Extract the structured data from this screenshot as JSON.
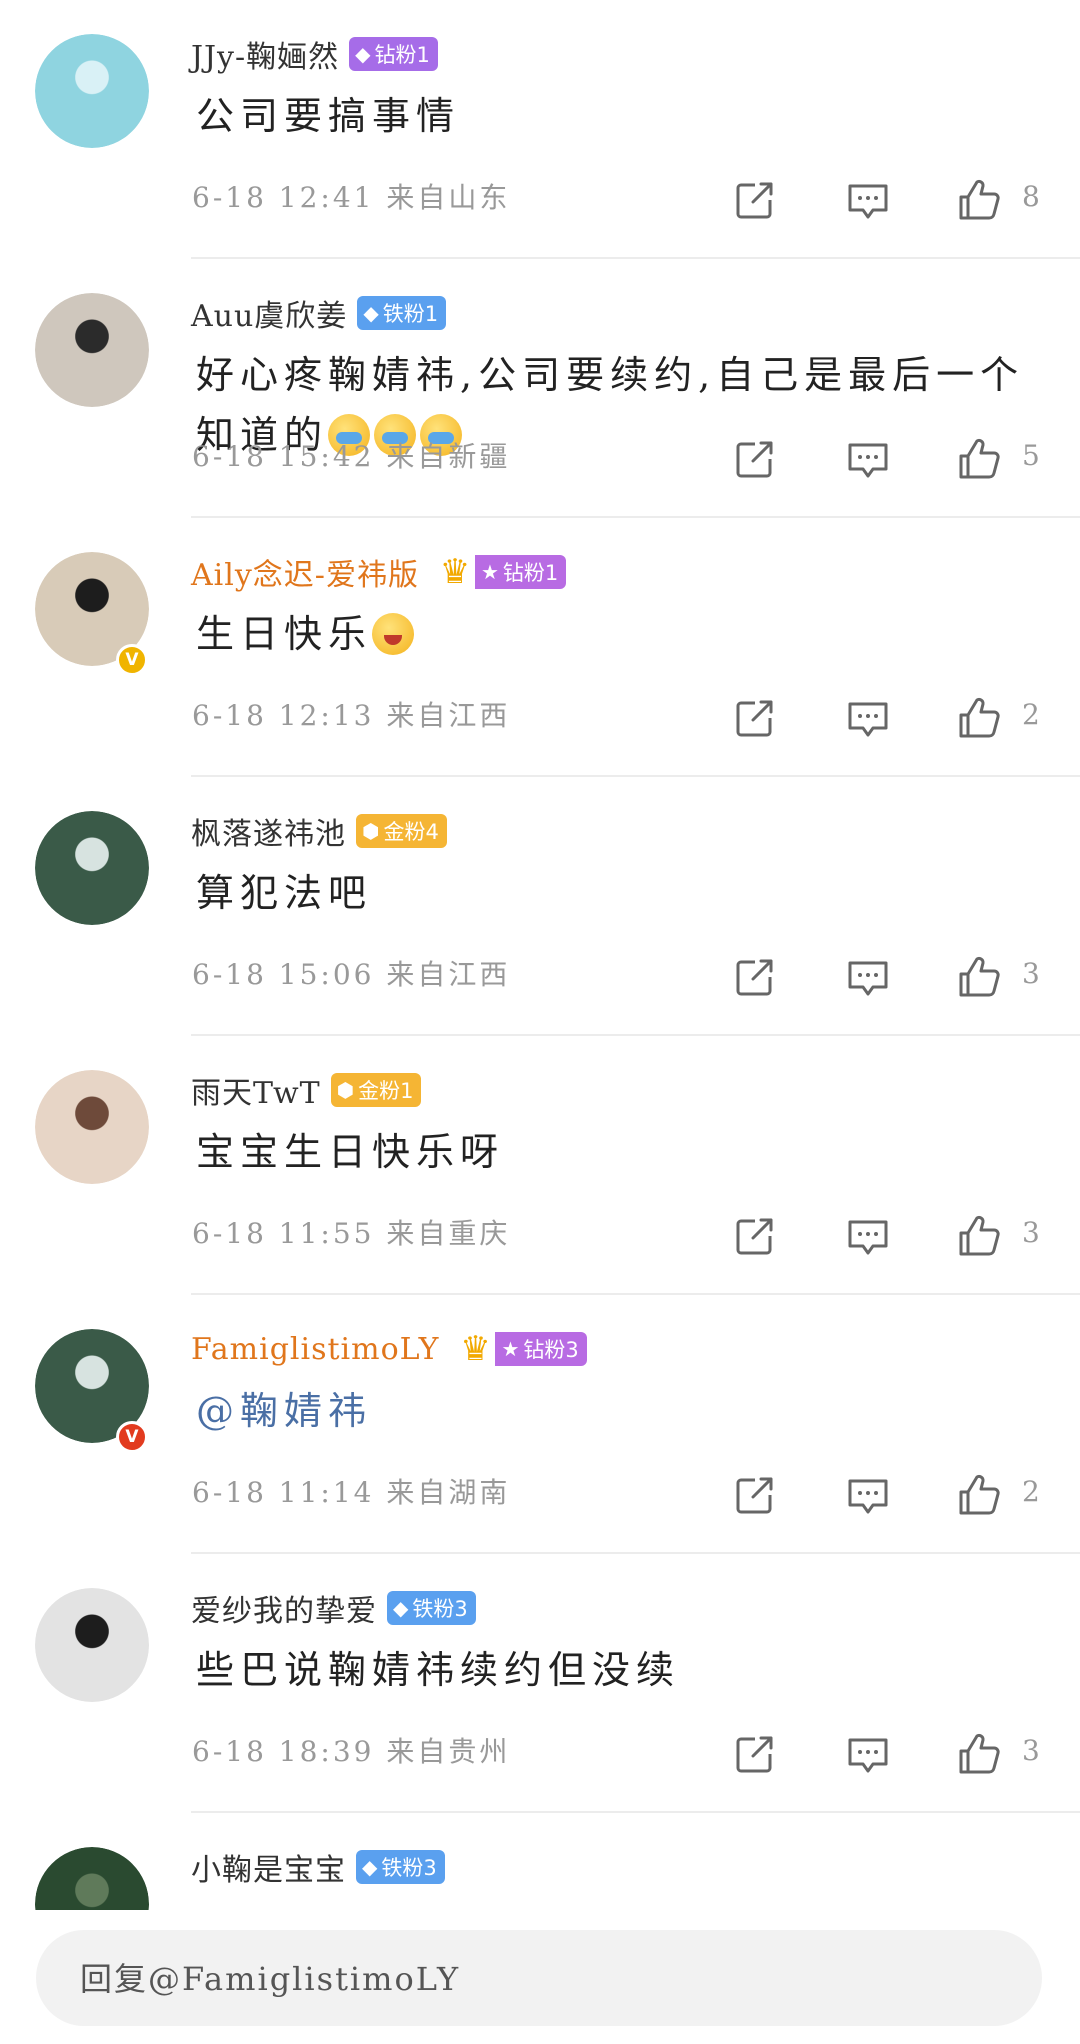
{
  "comments": [
    {
      "name": "JJy-鞠婳然",
      "name_style": "normal",
      "badge": {
        "label": "钻粉1",
        "icon": "diamond",
        "color": "#a66ce8"
      },
      "crown": false,
      "text": "公司要搞事情",
      "emojis": [],
      "time": "6-18 12:41",
      "location": "来自山东",
      "likes": "8",
      "avatar_colors": [
        "#8fd4e0",
        "#d9f1f6"
      ],
      "verified": false
    },
    {
      "name": "Auu虞欣姜",
      "name_style": "normal",
      "badge": {
        "label": "铁粉1",
        "icon": "diamond",
        "color": "#5aa0ef"
      },
      "crown": false,
      "text": "好心疼鞠婧祎,公司要续约,自己是最后一个知道的",
      "emojis": [
        "cry",
        "cry",
        "cry"
      ],
      "time": "6-18 15:42",
      "location": "来自新疆",
      "likes": "5",
      "avatar_colors": [
        "#cfc7bd",
        "#2b2b2b"
      ],
      "verified": false
    },
    {
      "name": "Aily念迟-爱祎版",
      "name_style": "vip",
      "badge": {
        "label": "钻粉1",
        "icon": "crown",
        "color": "#b86be3"
      },
      "crown": true,
      "text": "生日快乐",
      "emojis": [
        "happy"
      ],
      "time": "6-18 12:13",
      "location": "来自江西",
      "likes": "2",
      "avatar_colors": [
        "#d8cbb8",
        "#1d1d1d"
      ],
      "verified": true,
      "verified_color": "#f0b400"
    },
    {
      "name": "枫落遂祎池",
      "name_style": "normal",
      "badge": {
        "label": "金粉4",
        "icon": "gem",
        "color": "#f5b534"
      },
      "crown": false,
      "text": "算犯法吧",
      "emojis": [],
      "time": "6-18 15:06",
      "location": "来自江西",
      "likes": "3",
      "avatar_colors": [
        "#3a5a48",
        "#d7e3e0"
      ],
      "verified": false
    },
    {
      "name": "雨天TwT",
      "name_style": "normal",
      "badge": {
        "label": "金粉1",
        "icon": "gem",
        "color": "#f5b534"
      },
      "crown": false,
      "text": "宝宝生日快乐呀",
      "emojis": [],
      "time": "6-18 11:55",
      "location": "来自重庆",
      "likes": "3",
      "avatar_colors": [
        "#e7d5c6",
        "#6e4a3a"
      ],
      "verified": false
    },
    {
      "name": "FamiglistimoLY",
      "name_style": "vip",
      "badge": {
        "label": "钻粉3",
        "icon": "crown",
        "color": "#b86be3"
      },
      "crown": true,
      "text": "@鞠婧祎",
      "emojis": [],
      "time": "6-18 11:14",
      "location": "来自湖南",
      "likes": "2",
      "avatar_colors": [
        "#3a5a48",
        "#d7e3e0"
      ],
      "verified": true,
      "verified_color": "#e23b1f",
      "mention": true
    },
    {
      "name": "爱纱我的挚爱",
      "name_style": "normal",
      "badge": {
        "label": "铁粉3",
        "icon": "diamond",
        "color": "#5aa0ef"
      },
      "crown": false,
      "text": "些巴说鞠婧祎续约但没续",
      "emojis": [],
      "time": "6-18 18:39",
      "location": "来自贵州",
      "likes": "3",
      "avatar_colors": [
        "#e3e3e3",
        "#1d1d1d"
      ],
      "verified": false
    },
    {
      "name": "小鞠是宝宝",
      "name_style": "normal",
      "badge": {
        "label": "铁粉3",
        "icon": "diamond",
        "color": "#5aa0ef"
      },
      "crown": false,
      "text": "",
      "emojis": [],
      "time": "",
      "location": "",
      "likes": "",
      "avatar_colors": [
        "#2a4a30",
        "#5f7a5a"
      ],
      "verified": false
    }
  ],
  "reply_bar": {
    "placeholder": "回复@FamiglistimoLY"
  },
  "icons": {
    "share": "share-icon",
    "reply": "comment-icon",
    "like": "thumbs-up-icon"
  }
}
